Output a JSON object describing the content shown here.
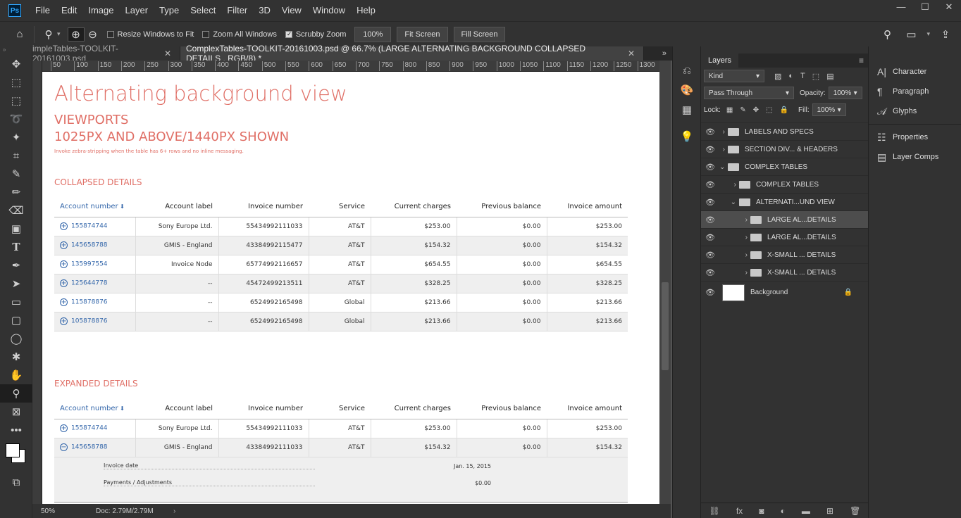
{
  "app": {
    "logo": "Ps"
  },
  "menu": [
    "File",
    "Edit",
    "Image",
    "Layer",
    "Type",
    "Select",
    "Filter",
    "3D",
    "View",
    "Window",
    "Help"
  ],
  "window_controls": [
    "—",
    "☐",
    "✕"
  ],
  "options": {
    "resize_windows": "Resize Windows to Fit",
    "zoom_all": "Zoom All Windows",
    "scrubby_zoom": "Scrubby Zoom",
    "zoom_value": "100%",
    "fit_screen": "Fit Screen",
    "fill_screen": "Fill Screen"
  },
  "tabs": [
    {
      "label": "impleTables-TOOLKIT-20161003.psd",
      "close": "✕"
    },
    {
      "label": "ComplexTables-TOOLKIT-20161003.psd @ 66.7% (LARGE ALTERNATING BACKGROUND COLLAPSED DETAILS , RGB/8) *",
      "close": "✕"
    }
  ],
  "ruler_ticks": [
    "50",
    "100",
    "150",
    "200",
    "250",
    "300",
    "350",
    "400",
    "450",
    "500",
    "550",
    "600",
    "650",
    "700",
    "750",
    "800",
    "850",
    "900",
    "950",
    "1000",
    "1050",
    "1100",
    "1150",
    "1200",
    "1250",
    "1300"
  ],
  "doc": {
    "title": "Alternating background view",
    "sub1": "VIEWPORTS",
    "sub2": "1025PX AND ABOVE/1440PX SHOWN",
    "note": "Invoke zebra-stripping when the table has 6+ rows and no inline messaging.",
    "collapsed_heading": "COLLAPSED DETAILS",
    "expanded_heading": "EXPANDED DETAILS",
    "columns": [
      "Account number",
      "Account label",
      "Invoice number",
      "Service",
      "Current charges",
      "Previous balance",
      "Invoice amount"
    ],
    "collapsed_rows": [
      [
        "155874744",
        "Sony Europe Ltd.",
        "55434992111033",
        "AT&T",
        "$253.00",
        "$0.00",
        "$253.00"
      ],
      [
        "145658788",
        "GMIS - England",
        "43384992115477",
        "AT&T",
        "$154.32",
        "$0.00",
        "$154.32"
      ],
      [
        "135997554",
        "Invoice Node",
        "65774992116657",
        "AT&T",
        "$654.55",
        "$0.00",
        "$654.55"
      ],
      [
        "125644778",
        "--",
        "45472499213511",
        "AT&T",
        "$328.25",
        "$0.00",
        "$328.25"
      ],
      [
        "115878876",
        "--",
        "6524992165498",
        "Global",
        "$213.66",
        "$0.00",
        "$213.66"
      ],
      [
        "105878876",
        "--",
        "6524992165498",
        "Global",
        "$213.66",
        "$0.00",
        "$213.66"
      ]
    ],
    "expanded_rows": [
      [
        "155874744",
        "Sony Europe Ltd.",
        "55434992111033",
        "AT&T",
        "$253.00",
        "$0.00",
        "$253.00"
      ],
      [
        "145658788",
        "GMIS - England",
        "43384992111033",
        "AT&T",
        "$154.32",
        "$0.00",
        "$154.32"
      ]
    ],
    "details": [
      {
        "label": "Invoice date",
        "value": "Jan. 15, 2015"
      },
      {
        "label": "Payments / Adjustments",
        "value": "$0.00"
      }
    ]
  },
  "status": {
    "zoom": "50%",
    "doc": "Doc: 2.79M/2.79M"
  },
  "layers": {
    "tab": "Layers",
    "kind": "Kind",
    "blend": "Pass Through",
    "opacity_label": "Opacity:",
    "opacity": "100%",
    "lock_label": "Lock:",
    "fill_label": "Fill:",
    "fill": "100%",
    "items": [
      {
        "name": "LABELS AND SPECS",
        "indent": 0,
        "sel": false
      },
      {
        "name": "SECTION DIV... & HEADERS",
        "indent": 0,
        "sel": false
      },
      {
        "name": "COMPLEX TABLES",
        "indent": 0,
        "sel": false
      },
      {
        "name": "COMPLEX TABLES",
        "indent": 1,
        "sel": false
      },
      {
        "name": "ALTERNATI...UND VIEW",
        "indent": 1,
        "sel": false
      },
      {
        "name": "LARGE AL...DETAILS",
        "indent": 2,
        "sel": true
      },
      {
        "name": "LARGE AL...DETAILS",
        "indent": 2,
        "sel": false
      },
      {
        "name": "X-SMALL ... DETAILS",
        "indent": 2,
        "sel": false
      },
      {
        "name": "X-SMALL ... DETAILS",
        "indent": 2,
        "sel": false
      }
    ],
    "background": "Background"
  },
  "right_panel": [
    "Character",
    "Paragraph",
    "Glyphs",
    "Properties",
    "Layer Comps"
  ]
}
